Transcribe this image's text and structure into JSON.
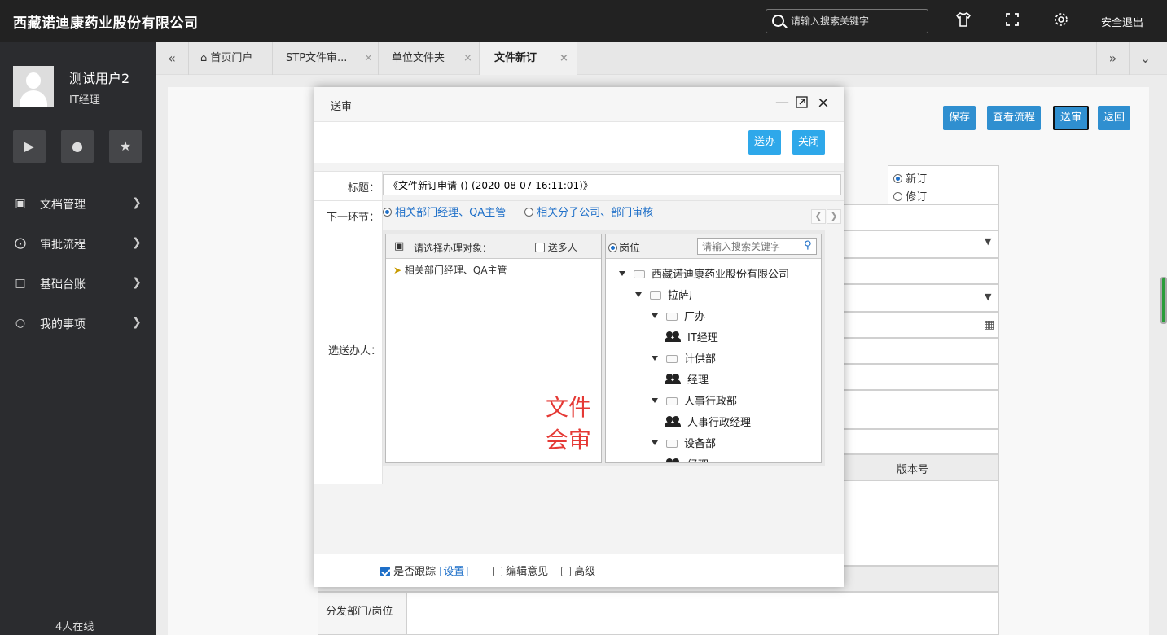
{
  "topbar": {
    "company": "西藏诺迪康药业股份有限公司",
    "search_placeholder": "请输入搜索关键字",
    "logout": "安全退出"
  },
  "sidebar": {
    "user_name": "测试用户2",
    "user_role": "IT经理",
    "menu": [
      {
        "label": "文档管理",
        "icon": "folder-icon"
      },
      {
        "label": "审批流程",
        "icon": "share-icon"
      },
      {
        "label": "基础台账",
        "icon": "ledger-icon"
      },
      {
        "label": "我的事项",
        "icon": "chat-icon"
      }
    ],
    "online": "4人在线"
  },
  "tabs": [
    {
      "label": "首页门户"
    },
    {
      "label": "STP文件审..."
    },
    {
      "label": "单位文件夹"
    },
    {
      "label": "文件新订"
    }
  ],
  "actions": {
    "save": "保存",
    "view_flow": "查看流程",
    "submit": "送审",
    "back": "返回"
  },
  "background_form": {
    "new": "新订",
    "revise": "修订",
    "version": "版本号",
    "distribute": "分发部门/岗位"
  },
  "modal": {
    "title": "送审",
    "send_btn": "送办",
    "close_btn": "关闭",
    "title_label": "标题：",
    "title_value": "《文件新订申请-()-(2020-08-07 16:11:01)》",
    "next_label": "下一环节：",
    "next_options": [
      "相关部门经理、QA主管",
      "相关分子公司、部门审核"
    ],
    "handler_label": "选送办人：",
    "left_header": "请选择办理对象：",
    "multi_send": "送多人",
    "selected_item": "相关部门经理、QA主管",
    "overlay_text": "文件会审",
    "right_header": "岗位",
    "tree_search_placeholder": "请输入搜索关键字",
    "tree": [
      {
        "label": "西藏诺迪康药业股份有限公司",
        "type": "folder",
        "level": 0
      },
      {
        "label": "拉萨厂",
        "type": "folder",
        "level": 1
      },
      {
        "label": "厂办",
        "type": "folder",
        "level": 2
      },
      {
        "label": "IT经理",
        "type": "people",
        "level": 3
      },
      {
        "label": "计供部",
        "type": "folder",
        "level": 2
      },
      {
        "label": "经理",
        "type": "people",
        "level": 3
      },
      {
        "label": "人事行政部",
        "type": "folder",
        "level": 2
      },
      {
        "label": "人事行政经理",
        "type": "people",
        "level": 3
      },
      {
        "label": "设备部",
        "type": "folder",
        "level": 2
      },
      {
        "label": "经理",
        "type": "people",
        "level": 3
      }
    ],
    "footer": {
      "track": "是否跟踪",
      "settings": "[设置]",
      "edit_opinion": "编辑意见",
      "advanced": "高级"
    }
  }
}
